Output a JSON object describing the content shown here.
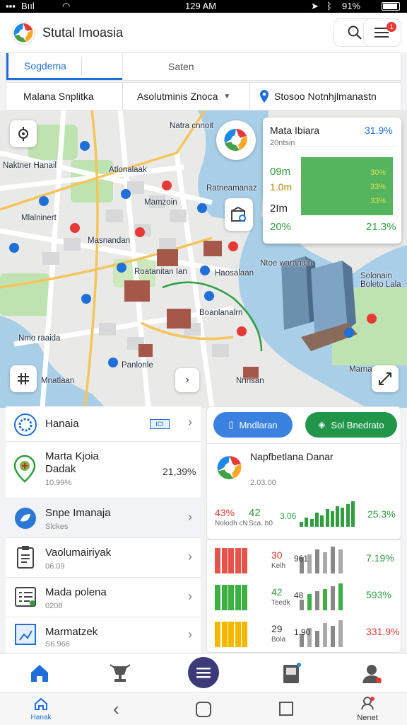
{
  "status": {
    "carrier": "Bııl",
    "time": "129 AM",
    "battery": "91%"
  },
  "header": {
    "title": "Stutal Imoasia",
    "notif_count": "1",
    "logo": "swirl-logo",
    "icons": [
      "search-icon",
      "menu-icon"
    ]
  },
  "tabs": [
    {
      "label": "Sogdema",
      "active": true
    },
    {
      "label": "Saten",
      "active": false
    }
  ],
  "filters": [
    "Malana Snplitka",
    "Asolutminis Znoca",
    "Stosoo Notnhjlmanastn"
  ],
  "map": {
    "labels": [
      "Naktner Hanail",
      "Mlalninert",
      "Atlonalaak",
      "Mamzoin",
      "Masnandan",
      "Roatanitan Ian",
      "Ratneamanaz",
      "Ntoe waranaln",
      "Natra cnnoit",
      "Haosalaan",
      "Boanlanalrn",
      "Nmo raaida",
      "Panlonle",
      "Mnatlaan",
      "Nnnsan",
      "Marna",
      "Solonain Boleto Lala"
    ],
    "pin_colors": [
      "#1e6fd9",
      "#e53935"
    ]
  },
  "stats": {
    "title": "Mata Ibiara",
    "pct": "31.9%",
    "sub": "20ntsin",
    "rows": [
      {
        "l": "09m",
        "r": "30%"
      },
      {
        "l": "1.0m",
        "r": "33%"
      },
      {
        "l": "2Im",
        "r": "33%"
      },
      {
        "l": "20%",
        "r": "21.3%"
      }
    ]
  },
  "list": [
    {
      "title": "Hanaia",
      "sub": "",
      "badge": "ICI",
      "icon": "globe-icon"
    },
    {
      "title": "Marta Kjoia Dadak",
      "sub": "10.99%",
      "value": "21,39%",
      "icon": "location-badge-icon"
    },
    {
      "title": "Snpe Imanaja",
      "sub": "Slckes",
      "icon": "leaf-icon"
    },
    {
      "title": "Vaolumairiyak",
      "sub": "06.09",
      "icon": "clipboard-icon"
    },
    {
      "title": "Mada polena",
      "sub": "0208",
      "icon": "document-icon"
    },
    {
      "title": "Marmatzek",
      "sub": "S6.966",
      "icon": "chart-board-icon"
    }
  ],
  "actions": {
    "primary": "Mndlaran",
    "secondary": "Sol Bnedrato"
  },
  "summary": {
    "title": "Napfbetlana Danar",
    "sub": "2.03.00",
    "metric_left": "43%",
    "metric_left_sub": "Nolodh cN",
    "metric_mid": "42",
    "metric_mid_sub": "Sca. b0",
    "metric_small": "3.06",
    "pct": "25.3%"
  },
  "bar_rows": [
    {
      "value": "30",
      "sub": "Kelh",
      "small": "961",
      "pct": "7.19%",
      "color": "#e5534b",
      "pct_color": "#2e9e3e",
      "levels": [
        0.95,
        0.95,
        0.95,
        0.95,
        0.95,
        0.6,
        0.7,
        0.9,
        0.8,
        1.0,
        0.9
      ]
    },
    {
      "value": "42",
      "sub": "Teedk",
      "small": "48",
      "pct": "593%",
      "color": "#3cb043",
      "pct_color": "#2e9e3e",
      "levels": [
        0.95,
        0.95,
        0.95,
        0.95,
        0.95,
        0.4,
        0.6,
        0.7,
        0.8,
        0.9,
        1.0
      ]
    },
    {
      "value": "29",
      "sub": "Bola",
      "small": "1.90",
      "pct": "331.9%",
      "color": "#f5b800",
      "pct_color": "#e53935",
      "levels": [
        0.95,
        0.95,
        0.95,
        0.95,
        0.95,
        0.5,
        0.7,
        0.6,
        0.9,
        0.8,
        1.0
      ]
    }
  ],
  "chart_data": {
    "type": "bar",
    "title": "",
    "series": [
      {
        "name": "",
        "values": [
          0.2,
          0.35,
          0.3,
          0.55,
          0.45,
          0.7,
          0.6,
          0.8,
          0.75,
          0.9,
          1.0
        ]
      }
    ]
  },
  "bottom_nav": [
    {
      "icon": "home-icon"
    },
    {
      "icon": "trophy-icon"
    },
    {
      "icon": "menu-circle-icon"
    },
    {
      "icon": "device-icon"
    },
    {
      "icon": "profile-icon"
    }
  ],
  "sys_nav": {
    "left_label": "Hanak",
    "right_label": "Nenet"
  }
}
